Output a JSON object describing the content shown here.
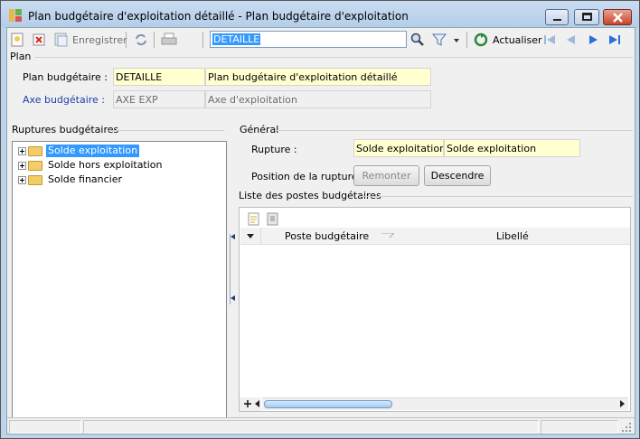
{
  "window": {
    "title": "Plan budgétaire d'exploitation détaillé -  Plan budgétaire d'exploitation"
  },
  "toolbar": {
    "save_label": "Enregistrer",
    "search_value": "DETAILLE",
    "refresh_label": "Actualiser"
  },
  "plan": {
    "section_title": "Plan",
    "plan_label": "Plan budgétaire :",
    "plan_code": "DETAILLE",
    "plan_name": "Plan budgétaire d'exploitation détaillé",
    "axis_label": "Axe budgétaire :",
    "axis_code": "AXE EXP",
    "axis_name": "Axe d'exploitation"
  },
  "breaks": {
    "section_title": "Ruptures budgétaires",
    "items": [
      {
        "label": "Solde exploitation",
        "selected": true
      },
      {
        "label": "Solde hors exploitation",
        "selected": false
      },
      {
        "label": "Solde financier",
        "selected": false
      }
    ]
  },
  "general": {
    "section_title": "Général",
    "rupture_label": "Rupture :",
    "rupture_code": "Solde exploitation",
    "rupture_name": "Solde exploitation",
    "position_label": "Position de la rupture :",
    "up_button": "Remonter",
    "down_button": "Descendre"
  },
  "posts": {
    "section_title": "Liste des postes budgétaires",
    "columns": [
      "Poste budgétaire",
      "Libellé"
    ],
    "rows": []
  },
  "colors": {
    "selection": "#3399ff",
    "required_field": "#ffffd0",
    "nav_arrow": "#2a6fd6"
  },
  "icons": [
    "new-icon",
    "delete-icon",
    "save-icon",
    "sync-icon",
    "print-icon",
    "search-icon",
    "filter-icon",
    "refresh-icon",
    "first-icon",
    "previous-icon",
    "next-icon",
    "last-icon",
    "folder-icon"
  ]
}
